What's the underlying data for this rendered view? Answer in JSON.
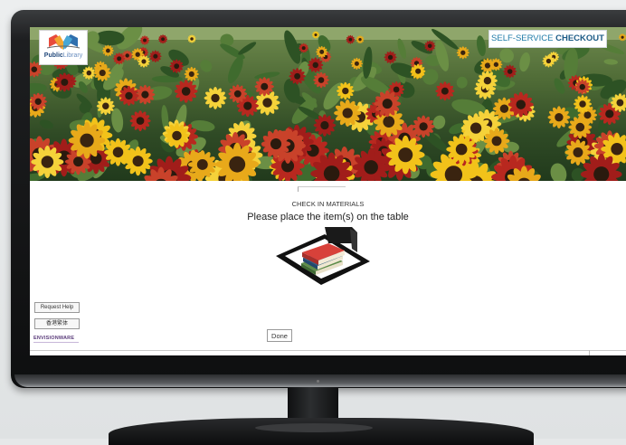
{
  "header": {
    "logo_bold": "Public",
    "logo_light": "Library",
    "title_light": "SELF-SERVICE ",
    "title_bold": "CHECKOUT"
  },
  "main": {
    "section_title": "CHECK IN MATERIALS",
    "instruction": "Please place the item(s) on the table"
  },
  "controls": {
    "help_label": "Request Help",
    "language_label": "香港繁体",
    "done_label": "Done"
  },
  "footer": {
    "vendor": "ENVISIONWARE"
  },
  "colors": {
    "brand_blue": "#1f7ba8",
    "brand_dark_blue": "#1c5b86",
    "vendor_purple": "#5a3b7a"
  },
  "icons": {
    "logo": "open-book-icon",
    "scanner": "book-scanner-icon"
  }
}
